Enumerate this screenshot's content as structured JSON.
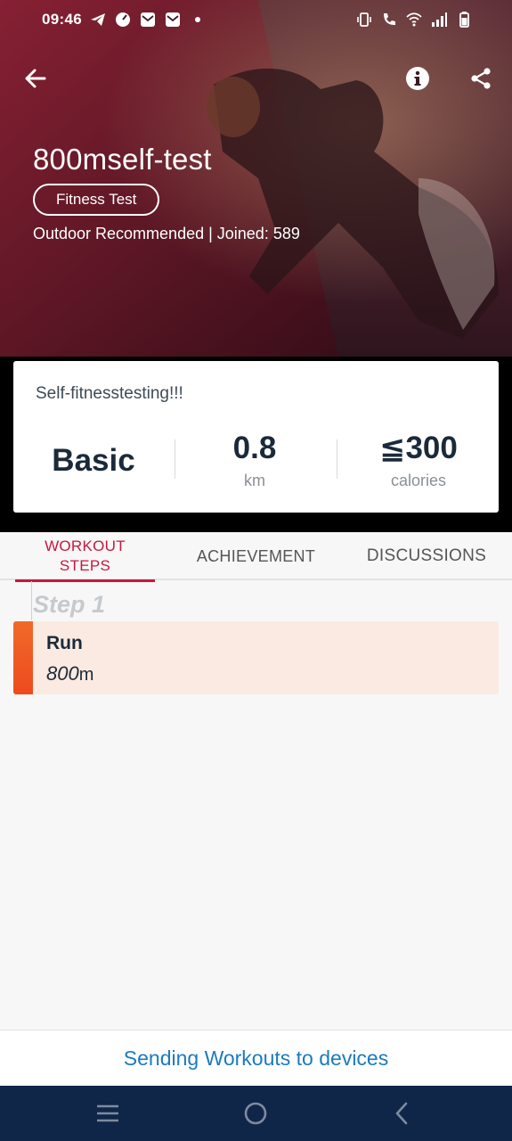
{
  "status_bar": {
    "time": "09:46",
    "left_icons": [
      "telegram-icon",
      "speedometer-icon",
      "mail-icon",
      "mail-icon",
      "dot-icon"
    ],
    "right_icons": [
      "vibrate-icon",
      "wifi-calling-icon",
      "wifi-icon",
      "signal-icon",
      "battery-icon"
    ]
  },
  "hero": {
    "title": "800mself-test",
    "tag": "Fitness Test",
    "subtitle": "Outdoor Recommended | Joined: 589"
  },
  "summary": {
    "description": "Self-fitnesstesting!!!",
    "level": "Basic",
    "distance_value": "0.8",
    "distance_unit": "km",
    "calories_value": "≦300",
    "calories_unit": "calories"
  },
  "tabs": {
    "workout_line1": "WORKOUT",
    "workout_line2": "STEPS",
    "achievement": "ACHIEVEMENT",
    "discussions": "DISCUSSIONS",
    "active": "workout"
  },
  "steps": [
    {
      "label": "Step 1",
      "name": "Run",
      "distance": "800",
      "unit": "m"
    }
  ],
  "footer": {
    "send_label": "Sending Workouts to devices"
  },
  "colors": {
    "accent": "#c8173f",
    "link": "#1b7bbf",
    "step_bar": "#ee4a1f",
    "nav_bg": "#0f2648"
  }
}
